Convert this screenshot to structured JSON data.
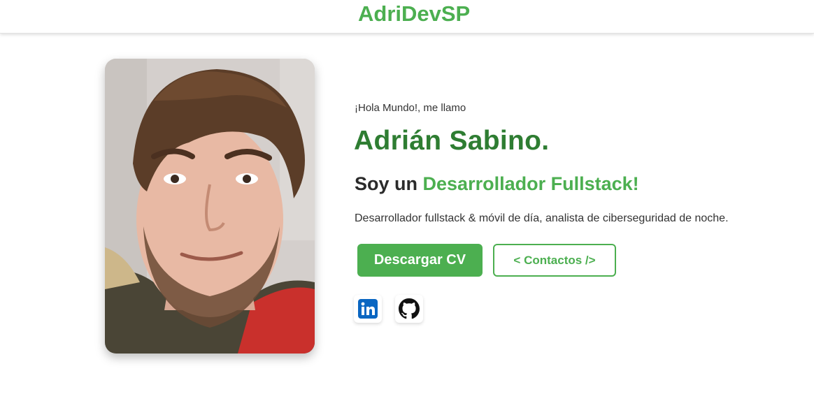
{
  "header": {
    "brand": "AdriDevSP"
  },
  "profile": {
    "photo_alt": "Adrián Sabino"
  },
  "hero": {
    "intro": "¡Hola Mundo!, me llamo",
    "name": "Adrián Sabino.",
    "role_prefix": "Soy un ",
    "role_highlight": "Desarrollador Fullstack!",
    "description": "Desarrollador fullstack & móvil de día, analista de ciberseguridad de noche."
  },
  "actions": {
    "download_cv": "Descargar CV",
    "contacts": "< Contactos />"
  },
  "social": [
    {
      "name": "linkedin-icon",
      "label": "LinkedIn"
    },
    {
      "name": "github-icon",
      "label": "GitHub"
    }
  ],
  "colors": {
    "accent": "#4caf50",
    "name_green": "#2e7d32",
    "linkedin_blue": "#0a66c2"
  }
}
